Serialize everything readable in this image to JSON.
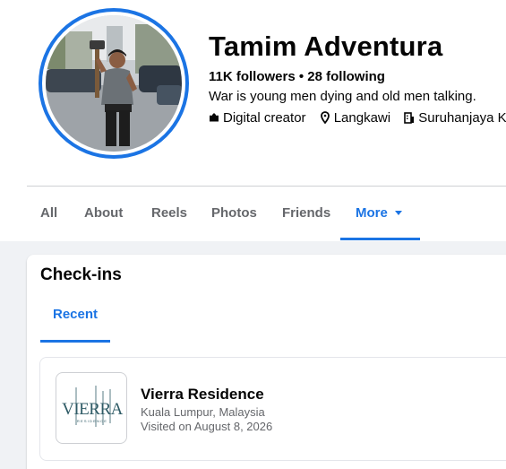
{
  "profile": {
    "name": "Tamim Adventura",
    "stats": "11K followers • 28 following",
    "bio": "War is young men dying and old men talking.",
    "meta": [
      {
        "icon": "briefcase-icon",
        "text": "Digital creator"
      },
      {
        "icon": "location-pin-icon",
        "text": "Langkawi"
      },
      {
        "icon": "building-icon",
        "text": "Suruhanjaya Koperasi Malaysia"
      }
    ]
  },
  "tabs": [
    {
      "label": "All"
    },
    {
      "label": "About"
    },
    {
      "label": "Reels"
    },
    {
      "label": "Photos"
    },
    {
      "label": "Friends"
    },
    {
      "label": "More",
      "active": true
    }
  ],
  "checkins": {
    "title": "Check-ins",
    "subtabs": [
      {
        "label": "Recent",
        "active": true
      }
    ],
    "items": [
      {
        "name": "Vierra Residence",
        "location": "Kuala Lumpur, Malaysia",
        "visited": "Visited on August 8, 2026",
        "logo_text": "VIERRA",
        "logo_subtext": "RESIDENCE"
      }
    ]
  },
  "colors": {
    "accent": "#1b74e4",
    "text_primary": "#050505",
    "text_secondary": "#65676b",
    "page_background": "#f0f2f5",
    "logo_teal": "#2f5b66"
  }
}
